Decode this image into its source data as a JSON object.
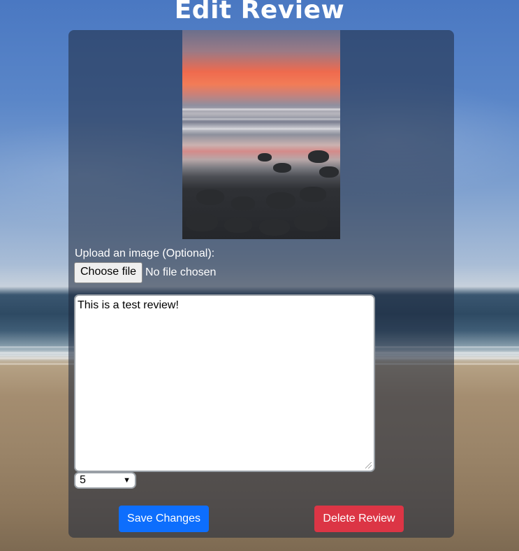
{
  "page": {
    "title": "Edit Review"
  },
  "form": {
    "upload_label": "Upload an image (Optional):",
    "file_button_label": "Choose file",
    "file_status": "No file chosen",
    "review_text": "This is a test review!",
    "rating_value": "5",
    "save_label": "Save Changes",
    "delete_label": "Delete Review"
  },
  "colors": {
    "save_button": "#0d6efd",
    "delete_button": "#dc3545",
    "card_overlay": "rgba(30,40,60,0.55)"
  },
  "icons": {
    "select_arrow": "chevron-down-icon"
  }
}
